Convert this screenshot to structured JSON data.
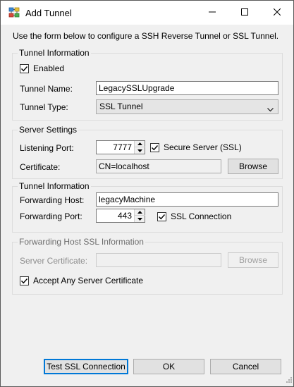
{
  "window": {
    "title": "Add Tunnel",
    "icons": {
      "app": "tunnel-app-icon",
      "minimize": "minimize-icon",
      "maximize": "maximize-icon",
      "close": "close-icon"
    }
  },
  "intro_text": "Use the form below to configure a SSH Reverse Tunnel or SSL Tunnel.",
  "tunnel_info": {
    "group_label": "Tunnel Information",
    "enabled_label": "Enabled",
    "enabled_checked": true,
    "name_label": "Tunnel Name:",
    "name_value": "LegacySSLUpgrade",
    "type_label": "Tunnel Type:",
    "type_value": "SSL Tunnel"
  },
  "server_settings": {
    "group_label": "Server Settings",
    "port_label": "Listening Port:",
    "port_value": "7777",
    "secure_label": "Secure Server (SSL)",
    "secure_checked": true,
    "cert_label": "Certificate:",
    "cert_value": "CN=localhost",
    "browse_label": "Browse"
  },
  "forward_info": {
    "group_label": "Tunnel Information",
    "host_label": "Forwarding Host:",
    "host_value": "legacyMachine",
    "port_label": "Forwarding Port:",
    "port_value": "443",
    "ssl_label": "SSL Connection",
    "ssl_checked": true
  },
  "forward_ssl": {
    "group_label": "Forwarding Host SSL Information",
    "cert_label": "Server Certificate:",
    "cert_value": "",
    "browse_label": "Browse",
    "accept_label": "Accept Any Server Certificate",
    "accept_checked": true
  },
  "buttons": {
    "test_label": "Test SSL Connection",
    "ok_label": "OK",
    "cancel_label": "Cancel"
  },
  "colors": {
    "accent": "#0078d7",
    "window_bg": "#f0f0f0"
  }
}
